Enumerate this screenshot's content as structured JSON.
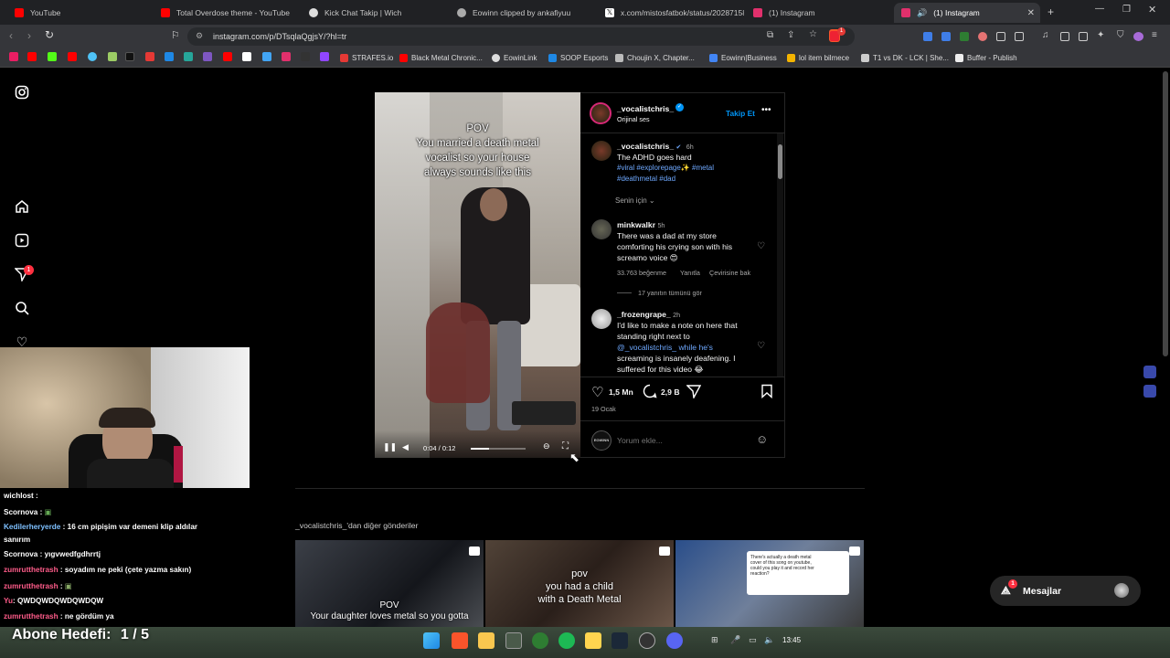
{
  "browser": {
    "tabs": [
      {
        "title": "YouTube",
        "color": "#ff0000"
      },
      {
        "title": "Total Overdose theme - YouTube",
        "color": "#ff0000"
      },
      {
        "title": "Kick Chat Takip | Wich",
        "color": "#d0d0d0"
      },
      {
        "title": "Eowinn clipped by ankafiyuu",
        "color": "#a0a0a0"
      },
      {
        "title": "x.com/mistosfatbok/status/20287158",
        "color": "#ffffff"
      },
      {
        "title": "(1) Instagram",
        "color": "#e1306c"
      },
      {
        "title": "(1) Instagram",
        "color": "#e1306c"
      }
    ],
    "url": "instagram.com/p/DTsqlaQgjsY/?hl=tr",
    "bookmarks": [
      "STRAFES.io",
      "Black Metal Chronic...",
      "EowinLink",
      "SOOP Esports",
      "Choujin X, Chapter...",
      "Eowinn|Business",
      "lol item bilmece",
      "T1 vs DK - LCK | She...",
      "Buffer - Publish"
    ],
    "notification_badge": "1"
  },
  "post": {
    "username": "_vocalistchris_",
    "audio": "Orijinal ses",
    "follow_label": "Takip Et",
    "video_caption_lines": [
      "POV",
      "You married a death metal",
      "vocalist so your house",
      "always sounds like this"
    ],
    "video_time": "0:04 / 0:12",
    "video_progress": 0.33,
    "caption_time": "6h",
    "caption_text": "The ADHD goes hard",
    "caption_tags": "#viral #explorepage✨ #metal",
    "caption_tags2": "#deathmetal #dad",
    "sort_label": "Senin için",
    "comments": [
      {
        "user": "minkwalkr",
        "time": "5h",
        "lines": [
          "There was a dad at my store",
          "comforting his crying son with his",
          "screamo voice 😍"
        ],
        "likes": "33.763 beğenme",
        "reply_label": "Yanıtla",
        "translate_label": "Çevirisine bak",
        "view_replies": "17 yanıtın tümünü gör"
      },
      {
        "user": "_frozengrape_",
        "time": "2h",
        "lines": [
          "I'd like to make a note on here that",
          "standing right next to",
          "@_vocalistchris_ while he's",
          "screaming is insanely deafening. I",
          "suffered for this video 😂"
        ]
      }
    ],
    "likes": "1,5 Mn",
    "comments_count": "2,9 B",
    "date": "19 Ocak",
    "comment_placeholder": "Yorum ekle...",
    "commenter_avatar_text": "EOWINN"
  },
  "more_posts": {
    "title": "_vocalistchris_'dan diğer gönderiler",
    "thumbs": [
      {
        "lines": [
          "POV",
          "Your daughter loves metal so you gotta"
        ]
      },
      {
        "lines": [
          "pov",
          "you had a child",
          "with a Death Metal"
        ]
      },
      {
        "lines": [
          "There's actually a death metal",
          "cover of this song on youtube,",
          "could you play it and record her",
          "reaction?"
        ]
      }
    ]
  },
  "messages": {
    "label": "Mesajlar",
    "badge": "1"
  },
  "stream_overlay": {
    "chat": [
      {
        "user": "wichlost",
        "text": "",
        "color": "#ffffff"
      },
      {
        "user": "Scornova",
        "text": "",
        "color": "#ffffff"
      },
      {
        "user": "Kedilerheryerde",
        "text": "16 cm pipişim var demeni klip aldılar",
        "color": "#7ec0ff"
      },
      {
        "user": "",
        "text": "sanırım",
        "color": "#ffffff"
      },
      {
        "user": "Scornova",
        "text": "yıgvwedfgdhrrtj",
        "color": "#ffffff"
      },
      {
        "user": "zumrutthetrash",
        "text": "soyadım ne peki (çete yazma sakın)",
        "color": "#ff5c8a"
      },
      {
        "user": "zumrutthetrash",
        "text": "",
        "color": "#ff5c8a"
      },
      {
        "user": "Yu",
        "text": "QWDQWDQWDQWDQW",
        "color": "#ff5c8a"
      },
      {
        "user": "zumrutthetrash",
        "text": "ne gördüm ya",
        "color": "#ff5c8a"
      }
    ],
    "goal_label": "Abone Hedefi:",
    "goal_value": "1 / 5"
  },
  "taskbar": {
    "time": "13:45"
  }
}
